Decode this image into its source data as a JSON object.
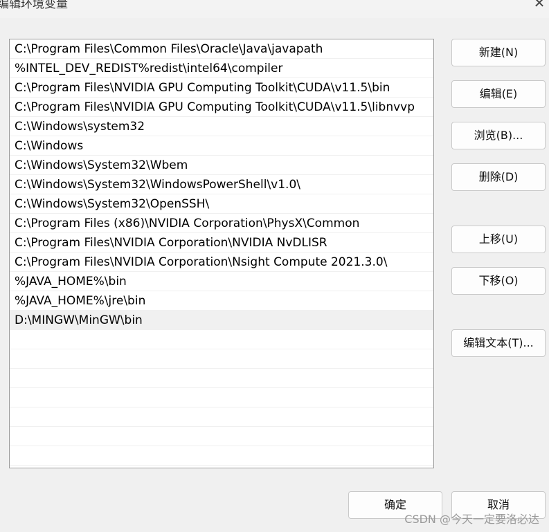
{
  "window": {
    "title": "编辑环境变量",
    "close_glyph": "✕"
  },
  "paths": [
    "C:\\Program Files\\Common Files\\Oracle\\Java\\javapath",
    "%INTEL_DEV_REDIST%redist\\intel64\\compiler",
    "C:\\Program Files\\NVIDIA GPU Computing Toolkit\\CUDA\\v11.5\\bin",
    "C:\\Program Files\\NVIDIA GPU Computing Toolkit\\CUDA\\v11.5\\libnvvp",
    "C:\\Windows\\system32",
    "C:\\Windows",
    "C:\\Windows\\System32\\Wbem",
    "C:\\Windows\\System32\\WindowsPowerShell\\v1.0\\",
    "C:\\Windows\\System32\\OpenSSH\\",
    "C:\\Program Files (x86)\\NVIDIA Corporation\\PhysX\\Common",
    "C:\\Program Files\\NVIDIA Corporation\\NVIDIA NvDLISR",
    "C:\\Program Files\\NVIDIA Corporation\\Nsight Compute 2021.3.0\\",
    "%JAVA_HOME%\\bin",
    "%JAVA_HOME%\\jre\\bin",
    "D:\\MINGW\\MinGW\\bin"
  ],
  "buttons": {
    "new": "新建(N)",
    "edit": "编辑(E)",
    "browse": "浏览(B)...",
    "delete": "删除(D)",
    "move_up": "上移(U)",
    "move_down": "下移(O)",
    "edit_text": "编辑文本(T)...",
    "ok": "确定",
    "cancel": "取消"
  },
  "watermark": "CSDN @今天一定要洛必达"
}
